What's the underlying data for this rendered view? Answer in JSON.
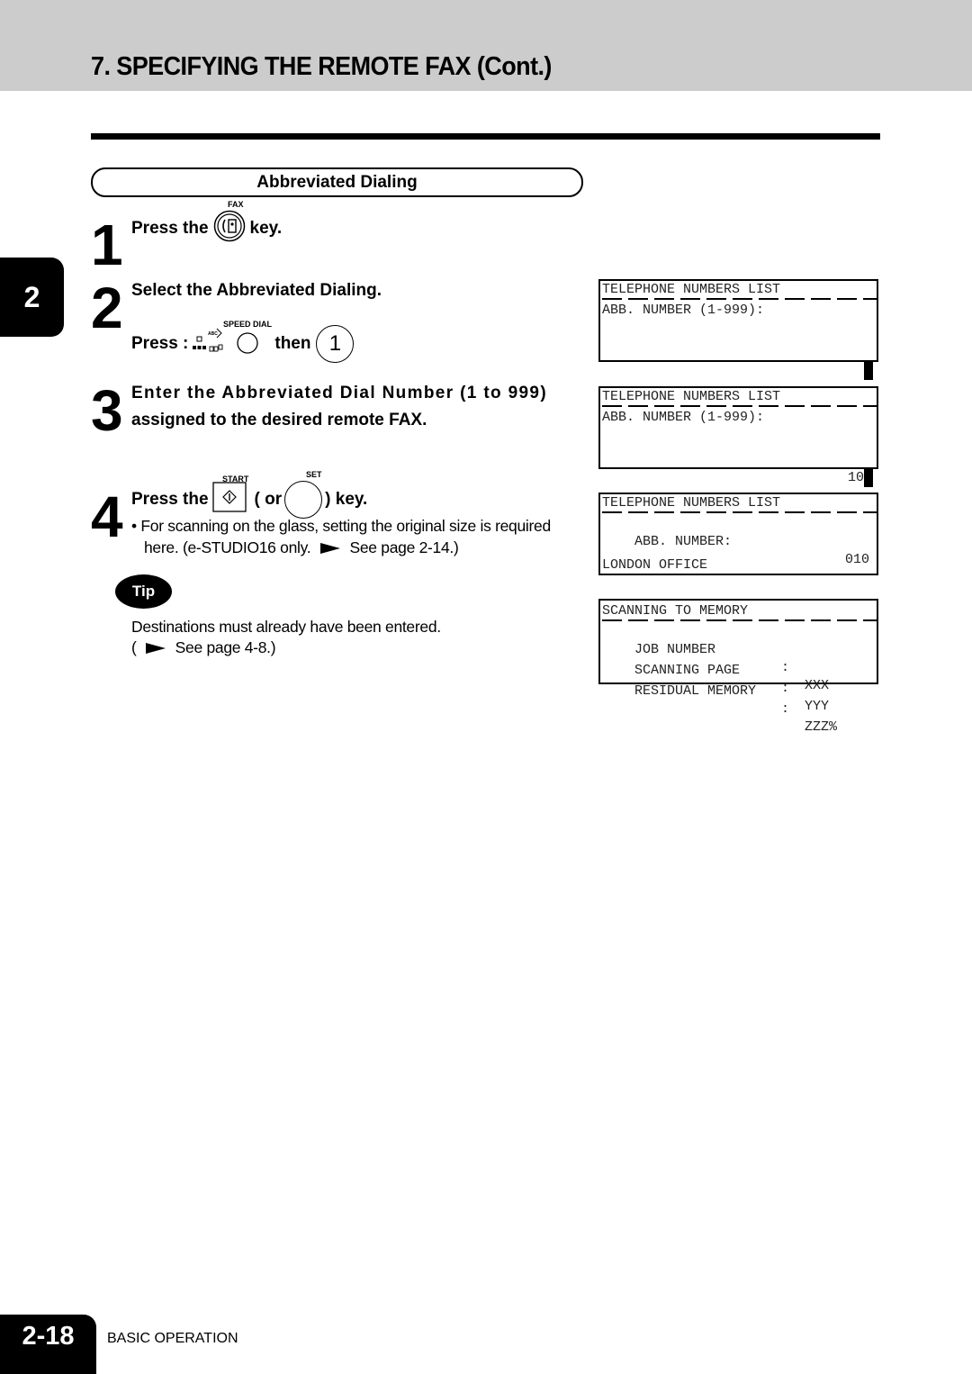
{
  "header": {
    "title": "7. SPECIFYING THE REMOTE FAX (Cont.)"
  },
  "chapter_tab": "2",
  "section": {
    "title": "Abbreviated Dialing"
  },
  "steps": [
    {
      "number": "1",
      "key_label": "FAX",
      "key_icon": "fax-key-icon",
      "text_before": "Press the",
      "text_after": "key."
    },
    {
      "number": "2",
      "text": "Select the Abbreviated Dialing.",
      "press_label": "Press :",
      "key_label": "SPEED DIAL",
      "key_icon": "speed-dial-key-icon",
      "then_label": "then",
      "then_key": "1"
    },
    {
      "number": "3",
      "line1": "Enter the Abbreviated Dial Number (1 to 999)",
      "line2": "assigned to the desired remote FAX."
    },
    {
      "number": "4",
      "text_before": "Press the",
      "start_label": "START",
      "start_icon": "start-key-icon",
      "or_label": "( or",
      "set_label": "SET",
      "text_after": ") key.",
      "bullet_line1": "For scanning on the glass, setting the original size is required",
      "bullet_line2_before": "here. (e-STUDIO16 only.",
      "bullet_line2_after": "See page 2-14.)"
    }
  ],
  "tip": {
    "badge": "Tip",
    "line1": "Destinations must already have been entered.",
    "line2_before": "(",
    "line2_after": "See page 4-8.)"
  },
  "lcd_screens": [
    {
      "title": "TELEPHONE NUMBERS LIST",
      "line2": "ABB. NUMBER (1-999):",
      "value": "",
      "cursor": true
    },
    {
      "title": "TELEPHONE NUMBERS LIST",
      "line2": "ABB. NUMBER (1-999):",
      "value": "10",
      "cursor": true
    },
    {
      "title": "TELEPHONE NUMBERS LIST",
      "line2": "ABB. NUMBER:",
      "line2_value": "010",
      "line4": "LONDON OFFICE"
    },
    {
      "title": "SCANNING TO MEMORY",
      "rows": [
        {
          "label": "JOB NUMBER",
          "sep": ":",
          "value": "XXX"
        },
        {
          "label": "SCANNING PAGE",
          "sep": ":",
          "value": "YYY"
        },
        {
          "label": "RESIDUAL MEMORY",
          "sep": ":",
          "value": "ZZZ%"
        }
      ]
    }
  ],
  "footer": {
    "page_number": "2-18",
    "section_label": "BASIC OPERATION"
  }
}
